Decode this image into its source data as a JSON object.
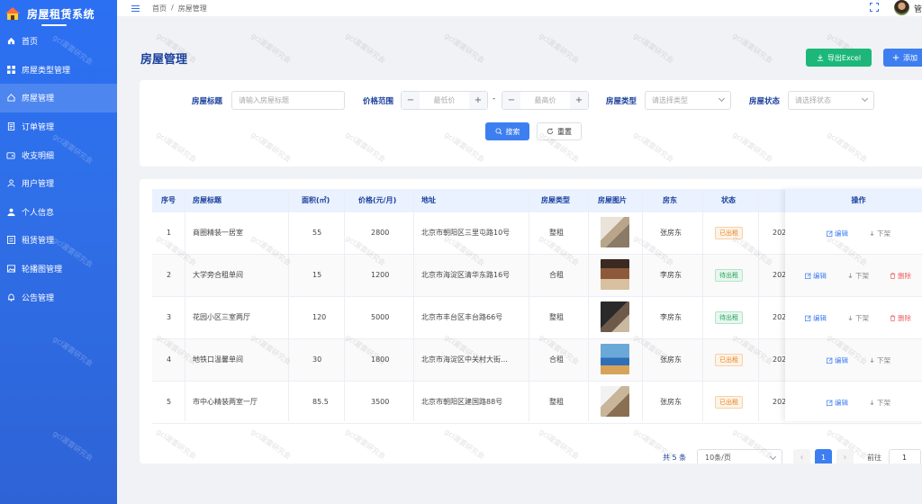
{
  "app": {
    "title": "房屋租赁系统"
  },
  "sidebar": {
    "items": [
      {
        "label": "首页",
        "icon": "home-icon"
      },
      {
        "label": "房屋类型管理",
        "icon": "grid-icon"
      },
      {
        "label": "房屋管理",
        "icon": "house-icon",
        "active": true
      },
      {
        "label": "订单管理",
        "icon": "document-icon"
      },
      {
        "label": "收支明细",
        "icon": "wallet-icon"
      },
      {
        "label": "用户管理",
        "icon": "user-icon"
      },
      {
        "label": "个人信息",
        "icon": "person-icon"
      },
      {
        "label": "租赁管理",
        "icon": "list-icon"
      },
      {
        "label": "轮播图管理",
        "icon": "image-icon"
      },
      {
        "label": "公告管理",
        "icon": "bell-icon"
      }
    ]
  },
  "topbar": {
    "breadcrumb": [
      "首页",
      "/",
      "房屋管理"
    ],
    "user_name": "管"
  },
  "page": {
    "title": "房屋管理",
    "export_label": "导出Excel",
    "add_label": "添加"
  },
  "search": {
    "title_label": "房屋标题",
    "title_placeholder": "请输入房屋标题",
    "price_label": "价格范围",
    "min_price_placeholder": "最低价",
    "max_price_placeholder": "最高价",
    "range_sep": "-",
    "type_label": "房屋类型",
    "type_placeholder": "请选择类型",
    "status_label": "房屋状态",
    "status_placeholder": "请选择状态",
    "search_label": "搜索",
    "reset_label": "重置"
  },
  "table": {
    "columns": [
      "序号",
      "房屋标题",
      "面积(㎡)",
      "价格(元/月)",
      "地址",
      "房屋类型",
      "房屋图片",
      "房东",
      "状态",
      "操作"
    ],
    "rows": [
      {
        "no": "1",
        "title": "商圈精装一居室",
        "area": "55",
        "price": "2800",
        "address": "北京市朝阳区三里屯路10号",
        "type": "整租",
        "landlord": "张房东",
        "status": "已出租",
        "status_kind": "rented",
        "date": "202",
        "actions": [
          "编辑",
          "下架"
        ]
      },
      {
        "no": "2",
        "title": "大学旁合租单间",
        "area": "15",
        "price": "1200",
        "address": "北京市海淀区清华东路16号",
        "type": "合租",
        "landlord": "李房东",
        "status": "待出租",
        "status_kind": "pending",
        "date": "202",
        "actions": [
          "编辑",
          "下架",
          "删除"
        ]
      },
      {
        "no": "3",
        "title": "花园小区三室两厅",
        "area": "120",
        "price": "5000",
        "address": "北京市丰台区丰台路66号",
        "type": "整租",
        "landlord": "李房东",
        "status": "待出租",
        "status_kind": "pending",
        "date": "202",
        "actions": [
          "编辑",
          "下架",
          "删除"
        ]
      },
      {
        "no": "4",
        "title": "地铁口温馨单间",
        "area": "30",
        "price": "1800",
        "address": "北京市海淀区中关村大街…",
        "type": "合租",
        "landlord": "张房东",
        "status": "已出租",
        "status_kind": "rented",
        "date": "202",
        "actions": [
          "编辑",
          "下架"
        ]
      },
      {
        "no": "5",
        "title": "市中心精装两室一厅",
        "area": "85.5",
        "price": "3500",
        "address": "北京市朝阳区建国路88号",
        "type": "整租",
        "landlord": "张房东",
        "status": "已出租",
        "status_kind": "rented",
        "date": "202",
        "actions": [
          "编辑",
          "下架"
        ]
      }
    ]
  },
  "pager": {
    "total": "共 5 条",
    "page_size": "10条/页",
    "current_page": "1",
    "goto_label": "前往",
    "goto_value": "1"
  },
  "watermark": "gcl渥雷研究会",
  "colors": {
    "primary": "#3d7ff0",
    "success": "#1bb87a",
    "sidebar": "#2f6fe8",
    "danger": "#f06060"
  }
}
